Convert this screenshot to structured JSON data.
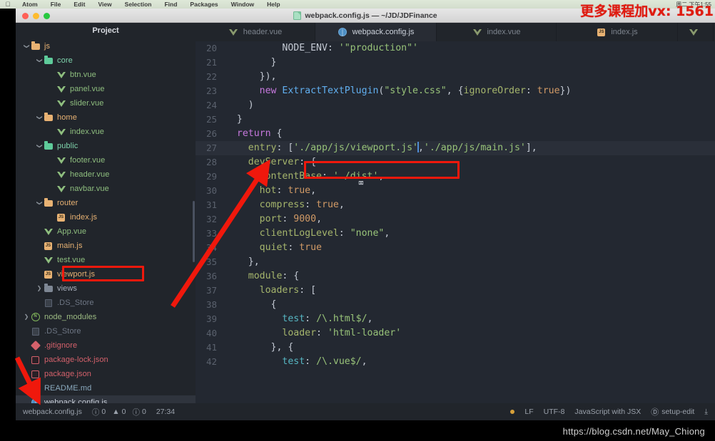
{
  "menubar": {
    "apple_icon": "apple-logo-icon",
    "items": [
      "Atom",
      "File",
      "Edit",
      "View",
      "Selection",
      "Find",
      "Packages",
      "Window",
      "Help"
    ],
    "right_items": [
      "周二 下午1:55"
    ]
  },
  "watermarks": {
    "top_red": "更多课程加vx: 1561",
    "bottom": "https://blog.csdn.net/May_Chiong"
  },
  "window": {
    "title": "webpack.config.js — ~/JD/JDFinance",
    "traffic_lights": [
      "close",
      "minimize",
      "zoom"
    ]
  },
  "sidebar": {
    "header": "Project",
    "tree": [
      {
        "label": "js",
        "depth": 0,
        "icon": "folder-orange-icon",
        "arrow": "down",
        "selected": false
      },
      {
        "label": "core",
        "depth": 1,
        "icon": "folder-green-icon",
        "arrow": "down",
        "selected": false
      },
      {
        "label": "btn.vue",
        "depth": 2,
        "icon": "vue-file-icon",
        "arrow": "none",
        "selected": false
      },
      {
        "label": "panel.vue",
        "depth": 2,
        "icon": "vue-file-icon",
        "arrow": "none",
        "selected": false
      },
      {
        "label": "slider.vue",
        "depth": 2,
        "icon": "vue-file-icon",
        "arrow": "none",
        "selected": false
      },
      {
        "label": "home",
        "depth": 1,
        "icon": "folder-orange-icon",
        "arrow": "down",
        "selected": false
      },
      {
        "label": "index.vue",
        "depth": 2,
        "icon": "vue-file-icon",
        "arrow": "none",
        "selected": false
      },
      {
        "label": "public",
        "depth": 1,
        "icon": "folder-green-icon",
        "arrow": "down",
        "selected": false
      },
      {
        "label": "footer.vue",
        "depth": 2,
        "icon": "vue-file-icon",
        "arrow": "none",
        "selected": false
      },
      {
        "label": "header.vue",
        "depth": 2,
        "icon": "vue-file-icon",
        "arrow": "none",
        "selected": false
      },
      {
        "label": "navbar.vue",
        "depth": 2,
        "icon": "vue-file-icon",
        "arrow": "none",
        "selected": false
      },
      {
        "label": "router",
        "depth": 1,
        "icon": "folder-orange-icon",
        "arrow": "down",
        "selected": false
      },
      {
        "label": "index.js",
        "depth": 2,
        "icon": "js-file-icon",
        "arrow": "none",
        "selected": false
      },
      {
        "label": "App.vue",
        "depth": 1,
        "icon": "vue-file-icon",
        "arrow": "none",
        "selected": false
      },
      {
        "label": "main.js",
        "depth": 1,
        "icon": "js-file-icon",
        "arrow": "none",
        "selected": false
      },
      {
        "label": "test.vue",
        "depth": 1,
        "icon": "vue-file-icon",
        "arrow": "none",
        "selected": false
      },
      {
        "label": "viewport.js",
        "depth": 1,
        "icon": "js-file-icon",
        "arrow": "none",
        "selected": false,
        "highlighted": true
      },
      {
        "label": "views",
        "depth": 1,
        "icon": "folder-grey-icon",
        "arrow": "right",
        "selected": false
      },
      {
        "label": ".DS_Store",
        "depth": 1,
        "icon": "ds-store-icon",
        "arrow": "none",
        "selected": false
      },
      {
        "label": "node_modules",
        "depth": 0,
        "icon": "node-module-icon",
        "arrow": "right",
        "selected": false
      },
      {
        "label": ".DS_Store",
        "depth": 0,
        "icon": "ds-store-icon",
        "arrow": "none",
        "selected": false
      },
      {
        "label": ".gitignore",
        "depth": 0,
        "icon": "gitignore-icon",
        "arrow": "none",
        "selected": false
      },
      {
        "label": "package-lock.json",
        "depth": 0,
        "icon": "json-file-icon",
        "arrow": "none",
        "selected": false
      },
      {
        "label": "package.json",
        "depth": 0,
        "icon": "json-file-icon",
        "arrow": "none",
        "selected": false
      },
      {
        "label": "README.md",
        "depth": 0,
        "icon": "markdown-file-icon",
        "arrow": "none",
        "selected": false
      },
      {
        "label": "webpack.config.js",
        "depth": 0,
        "icon": "webpack-file-icon",
        "arrow": "none",
        "selected": true
      }
    ]
  },
  "tabs": [
    {
      "label": "header.vue",
      "icon": "vue-file-icon",
      "active": false
    },
    {
      "label": "webpack.config.js",
      "icon": "webpack-file-icon",
      "active": true
    },
    {
      "label": "index.vue",
      "icon": "vue-file-icon",
      "active": false
    },
    {
      "label": "index.js",
      "icon": "js-file-icon",
      "active": false
    },
    {
      "label": "",
      "icon": "vue-file-icon",
      "active": false
    }
  ],
  "code": {
    "first_line_number": 20,
    "active_line": 27,
    "lines": [
      {
        "n": 20,
        "html": "          NODE_ENV: <span class='str'>'\"production\"'</span>"
      },
      {
        "n": 21,
        "html": "        }"
      },
      {
        "n": 22,
        "html": "      }),"
      },
      {
        "n": 23,
        "html": "      <span class='k'>new</span> <span class='fn'>ExtractTextPlugin</span>(<span class='str'>\"style.css\"</span>, {<span class='prop'>ignoreOrder</span>: <span class='num'>true</span>})"
      },
      {
        "n": 24,
        "html": "    )"
      },
      {
        "n": 25,
        "html": "  }"
      },
      {
        "n": 26,
        "html": "  <span class='k'>return</span> {"
      },
      {
        "n": 27,
        "html": "    <span class='prop'>entry</span>: [<span class='str'>'./app/js/viewport.js'</span><span class='caret'></span>,<span class='str'>'./app/js/main.js'</span>],"
      },
      {
        "n": 28,
        "html": "    <span class='prop'>devServer</span>: {"
      },
      {
        "n": 29,
        "html": "      <span class='prop'>contentBase</span>: <span class='str'>'./dist'</span>,"
      },
      {
        "n": 30,
        "html": "      <span class='prop'>hot</span>: <span class='num'>true</span>,"
      },
      {
        "n": 31,
        "html": "      <span class='prop'>compress</span>: <span class='num'>true</span>,"
      },
      {
        "n": 32,
        "html": "      <span class='prop'>port</span>: <span class='num'>9000</span>,"
      },
      {
        "n": 33,
        "html": "      <span class='prop'>clientLogLevel</span>: <span class='str'>\"none\"</span>,"
      },
      {
        "n": 34,
        "html": "      <span class='prop'>quiet</span>: <span class='num'>true</span>"
      },
      {
        "n": 35,
        "html": "    },"
      },
      {
        "n": 36,
        "html": "    <span class='prop'>module</span>: {"
      },
      {
        "n": 37,
        "html": "      <span class='prop'>loaders</span>: ["
      },
      {
        "n": 38,
        "html": "        {"
      },
      {
        "n": 39,
        "html": "          <span class='rgx'>test</span>: <span class='str'>/\\.html$/</span>,"
      },
      {
        "n": 40,
        "html": "          <span class='prop'>loader</span>: <span class='str'>'html-loader'</span>"
      },
      {
        "n": 41,
        "html": "        }, {"
      },
      {
        "n": 42,
        "html": "          <span class='rgx'>test</span>: <span class='str'>/\\.vue$/</span>,"
      }
    ]
  },
  "statusbar": {
    "filename": "webpack.config.js",
    "errors": "0",
    "warnings": "0",
    "info": "0",
    "cursor_position": "27:34",
    "line_ending": "LF",
    "encoding": "UTF-8",
    "grammar": "JavaScript with JSX",
    "branch": "setup-edit",
    "branch_icon": "git-branch-icon",
    "updates_icon": "download-arrow-icon",
    "modified_dot": "unsaved-changes-dot"
  },
  "annotations": {
    "tree_highlight_label": "viewport.js",
    "code_highlight_label": "'./app/js/viewport.js'",
    "arrow_long_label": "points-to-entry-value",
    "arrow_short_label": "points-to-webpack-config-file"
  },
  "colors": {
    "annotation_red": "#f0180c",
    "editor_bg": "#232831",
    "sidebar_bg": "#21252b",
    "active_line": "#2a2f39",
    "accent_blue": "#4f8bd4"
  }
}
